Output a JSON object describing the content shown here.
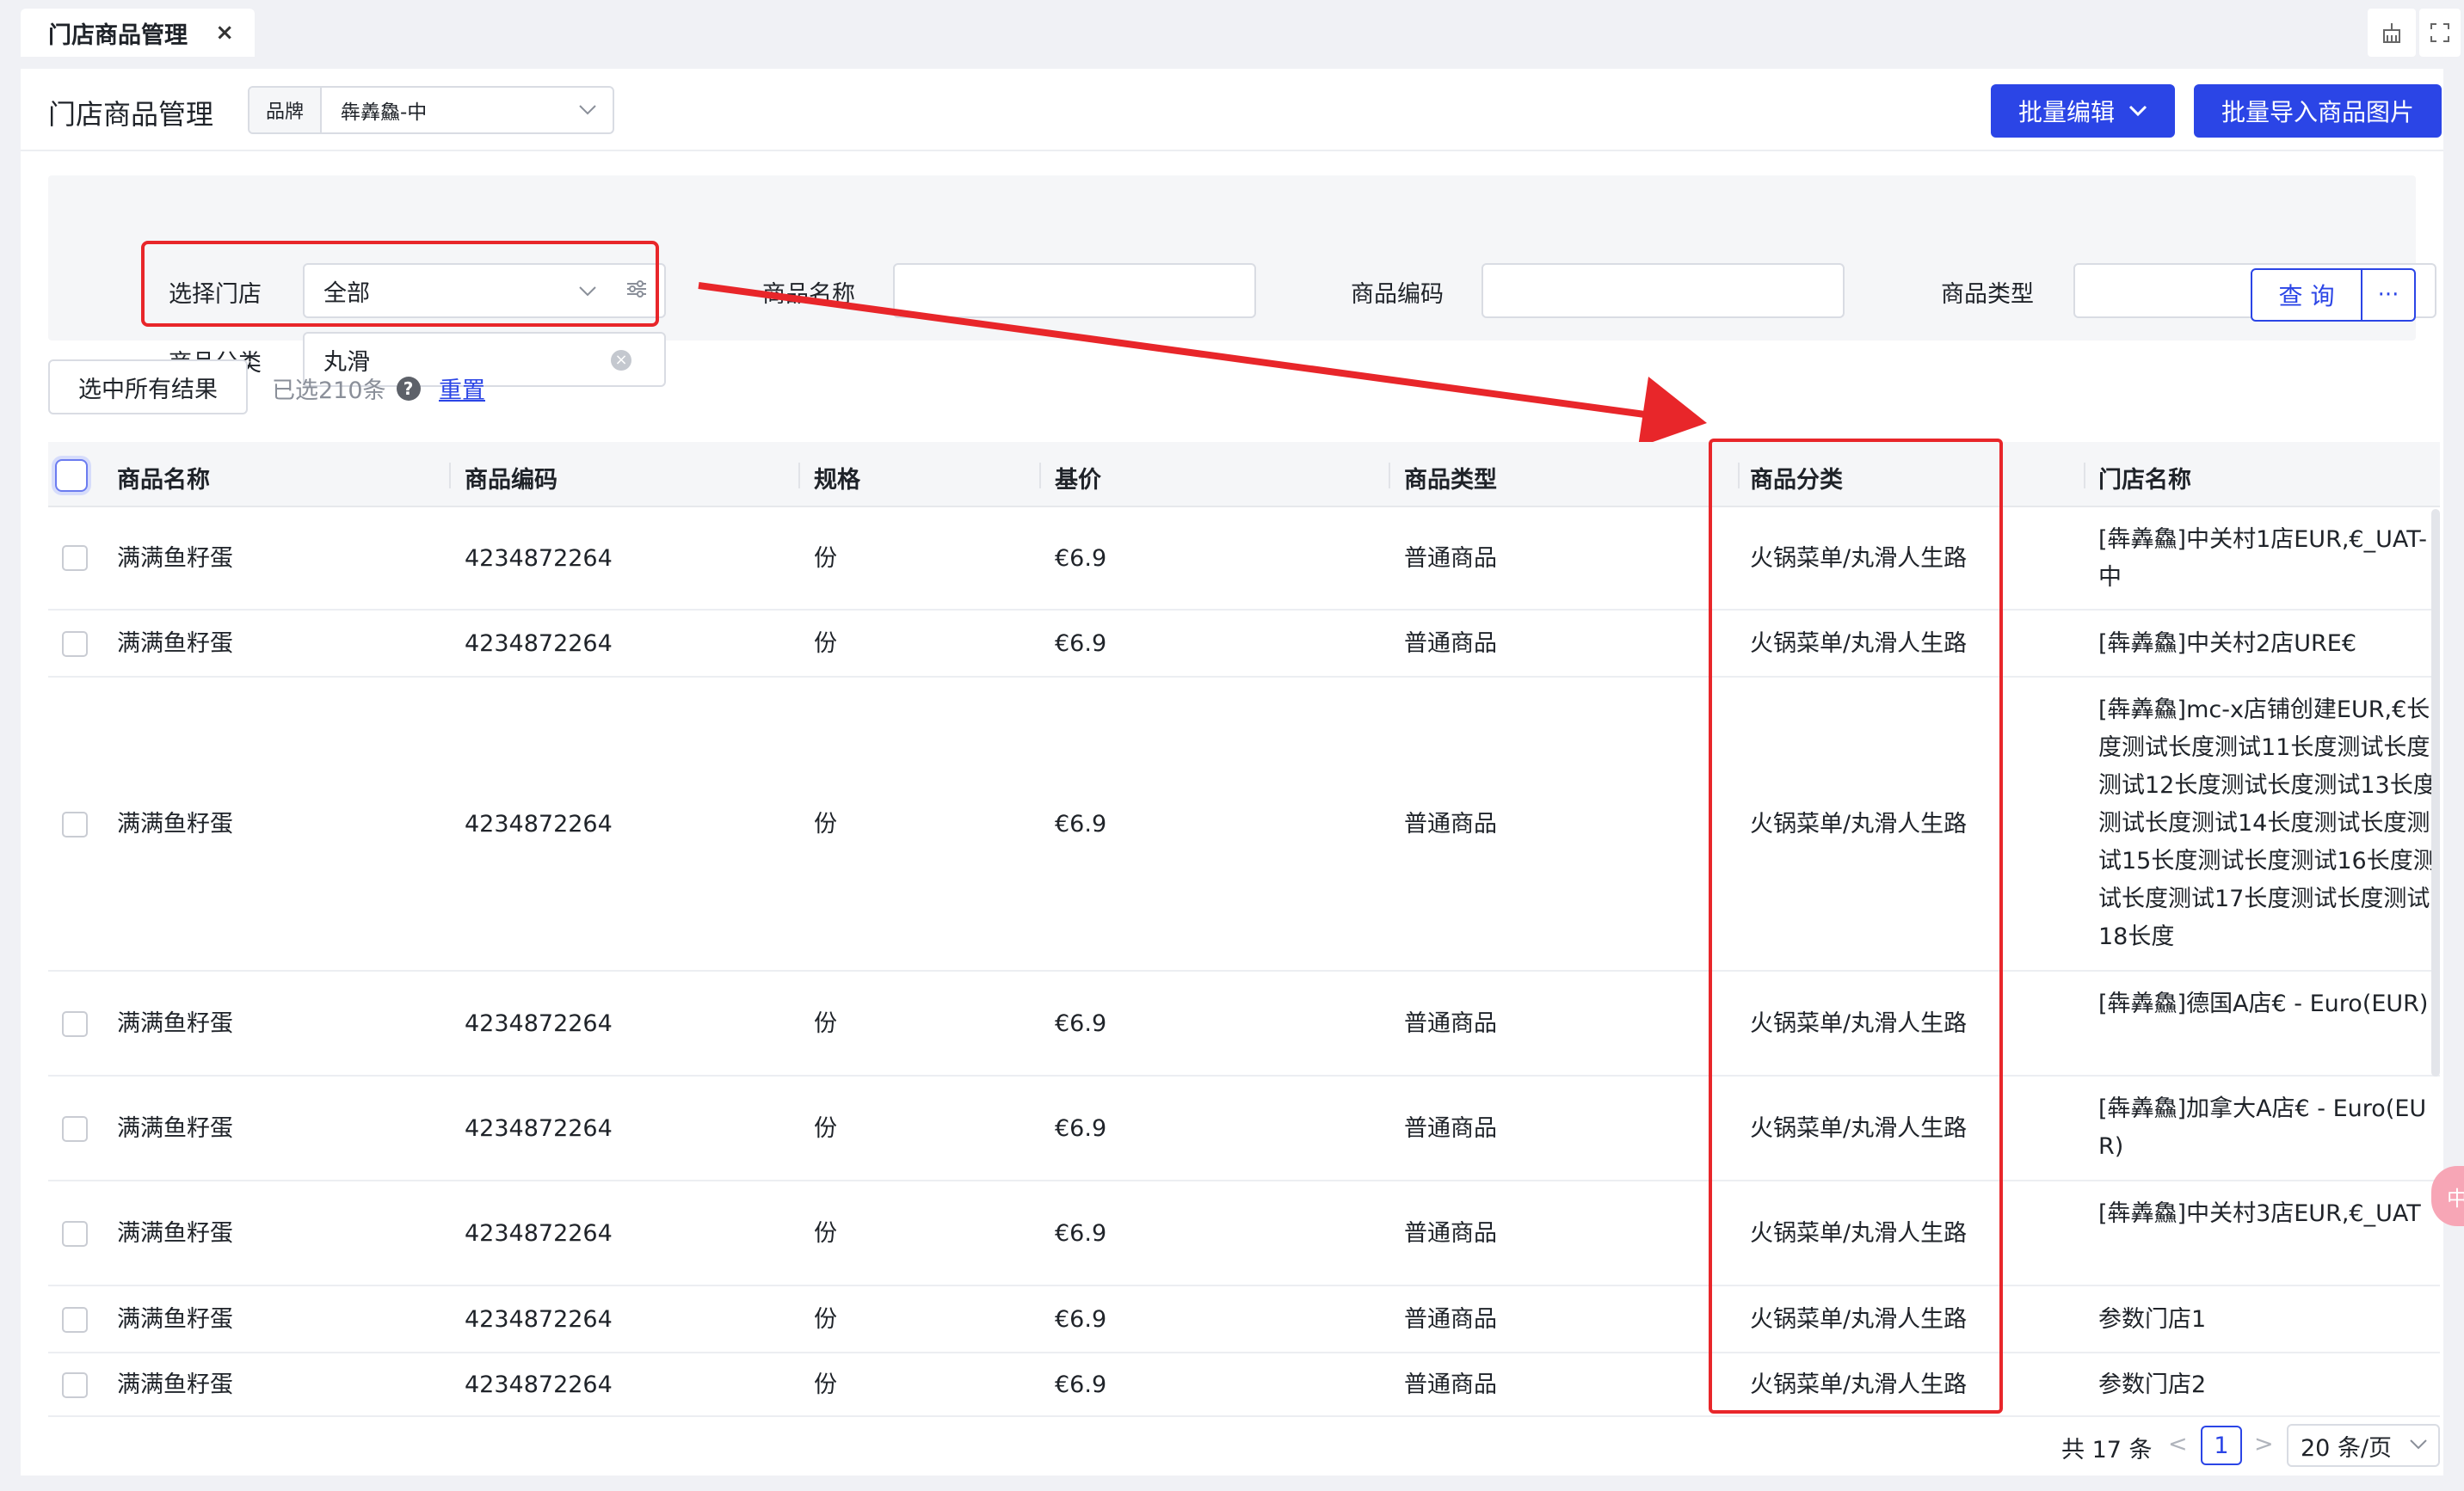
{
  "tabs": [
    {
      "label": "门店商品管理",
      "close": "×"
    }
  ],
  "header": {
    "title": "门店商品管理",
    "brand_label": "品牌",
    "brand_value": "犇羴鱻-中",
    "batch_edit_label": "批量编辑",
    "batch_import_label": "批量导入商品图片"
  },
  "filters": {
    "store_label": "选择门店",
    "store_value": "全部",
    "name_label": "商品名称",
    "name_value": "",
    "code_label": "商品编码",
    "code_value": "",
    "type_label": "商品类型",
    "type_value": "",
    "category_label": "商品分类",
    "category_value": "丸滑",
    "query_label": "查 询",
    "more_label": "···"
  },
  "selection": {
    "select_all_label": "选中所有结果",
    "selected_text": "已选210条",
    "help": "?",
    "reset_label": "重置"
  },
  "table": {
    "columns": [
      "商品名称",
      "商品编码",
      "规格",
      "基价",
      "商品类型",
      "商品分类",
      "门店名称"
    ],
    "rows": [
      {
        "name": "满满鱼籽蛋",
        "code": "4234872264",
        "spec": "份",
        "price": "€6.9",
        "type": "普通商品",
        "category": "火锅菜单/丸滑人生路",
        "store": "[犇羴鱻]中关村1店EUR,€_UAT-中"
      },
      {
        "name": "满满鱼籽蛋",
        "code": "4234872264",
        "spec": "份",
        "price": "€6.9",
        "type": "普通商品",
        "category": "火锅菜单/丸滑人生路",
        "store": "[犇羴鱻]中关村2店URE€"
      },
      {
        "name": "满满鱼籽蛋",
        "code": "4234872264",
        "spec": "份",
        "price": "€6.9",
        "type": "普通商品",
        "category": "火锅菜单/丸滑人生路",
        "store": "[犇羴鱻]mc-x店铺创建EUR,€长度测试长度测试11长度测试长度测试12长度测试长度测试13长度测试长度测试14长度测试长度测试15长度测试长度测试16长度测试长度测试17长度测试长度测试18长度"
      },
      {
        "name": "满满鱼籽蛋",
        "code": "4234872264",
        "spec": "份",
        "price": "€6.9",
        "type": "普通商品",
        "category": "火锅菜单/丸滑人生路",
        "store": "[犇羴鱻]德国A店€ - Euro(EUR)"
      },
      {
        "name": "满满鱼籽蛋",
        "code": "4234872264",
        "spec": "份",
        "price": "€6.9",
        "type": "普通商品",
        "category": "火锅菜单/丸滑人生路",
        "store": "[犇羴鱻]加拿大A店€ - Euro(EUR)"
      },
      {
        "name": "满满鱼籽蛋",
        "code": "4234872264",
        "spec": "份",
        "price": "€6.9",
        "type": "普通商品",
        "category": "火锅菜单/丸滑人生路",
        "store": "[犇羴鱻]中关村3店EUR,€_UAT"
      },
      {
        "name": "满满鱼籽蛋",
        "code": "4234872264",
        "spec": "份",
        "price": "€6.9",
        "type": "普通商品",
        "category": "火锅菜单/丸滑人生路",
        "store": "参数门店1"
      },
      {
        "name": "满满鱼籽蛋",
        "code": "4234872264",
        "spec": "份",
        "price": "€6.9",
        "type": "普通商品",
        "category": "火锅菜单/丸滑人生路",
        "store": "参数门店2"
      }
    ]
  },
  "pagination": {
    "total": "共 17 条",
    "prev": "<",
    "current": "1",
    "next": ">",
    "page_size": "20 条/页"
  },
  "floating": {
    "chip": "中"
  },
  "colors": {
    "primary": "#2b45e6",
    "annotation_red": "#e8262a"
  }
}
